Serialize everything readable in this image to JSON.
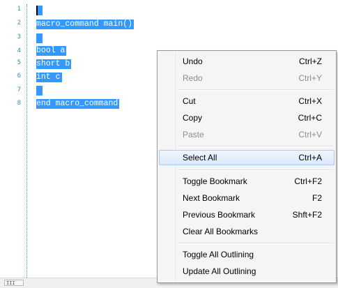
{
  "editor": {
    "line_numbers": [
      "1",
      "2",
      "3",
      "4",
      "5",
      "6",
      "7",
      "8"
    ],
    "lines": {
      "line2": "macro_command main()",
      "line4": "bool a",
      "line5": "short b",
      "line6": "int c",
      "line8": "end macro_command"
    },
    "scrollbar_thumb_label": "III"
  },
  "context_menu": {
    "items": {
      "undo": {
        "label": "Undo",
        "shortcut": "Ctrl+Z"
      },
      "redo": {
        "label": "Redo",
        "shortcut": "Ctrl+Y"
      },
      "cut": {
        "label": "Cut",
        "shortcut": "Ctrl+X"
      },
      "copy": {
        "label": "Copy",
        "shortcut": "Ctrl+C"
      },
      "paste": {
        "label": "Paste",
        "shortcut": "Ctrl+V"
      },
      "select_all": {
        "label": "Select All",
        "shortcut": "Ctrl+A"
      },
      "toggle_bookmark": {
        "label": "Toggle Bookmark",
        "shortcut": "Ctrl+F2"
      },
      "next_bookmark": {
        "label": "Next Bookmark",
        "shortcut": "F2"
      },
      "previous_bookmark": {
        "label": "Previous Bookmark",
        "shortcut": "Shft+F2"
      },
      "clear_all_bookmarks": {
        "label": "Clear All Bookmarks",
        "shortcut": ""
      },
      "toggle_all_outlining": {
        "label": "Toggle All Outlining",
        "shortcut": ""
      },
      "update_all_outlining": {
        "label": "Update All Outlining",
        "shortcut": ""
      }
    },
    "disabled": [
      "redo",
      "paste"
    ],
    "highlighted": "select_all"
  },
  "colors": {
    "selection": "#3399ff",
    "line_number": "#2b91af",
    "outline_guide": "#35b27a",
    "menu_background": "#f5f5f5",
    "disabled_text": "#8d8d8d"
  }
}
